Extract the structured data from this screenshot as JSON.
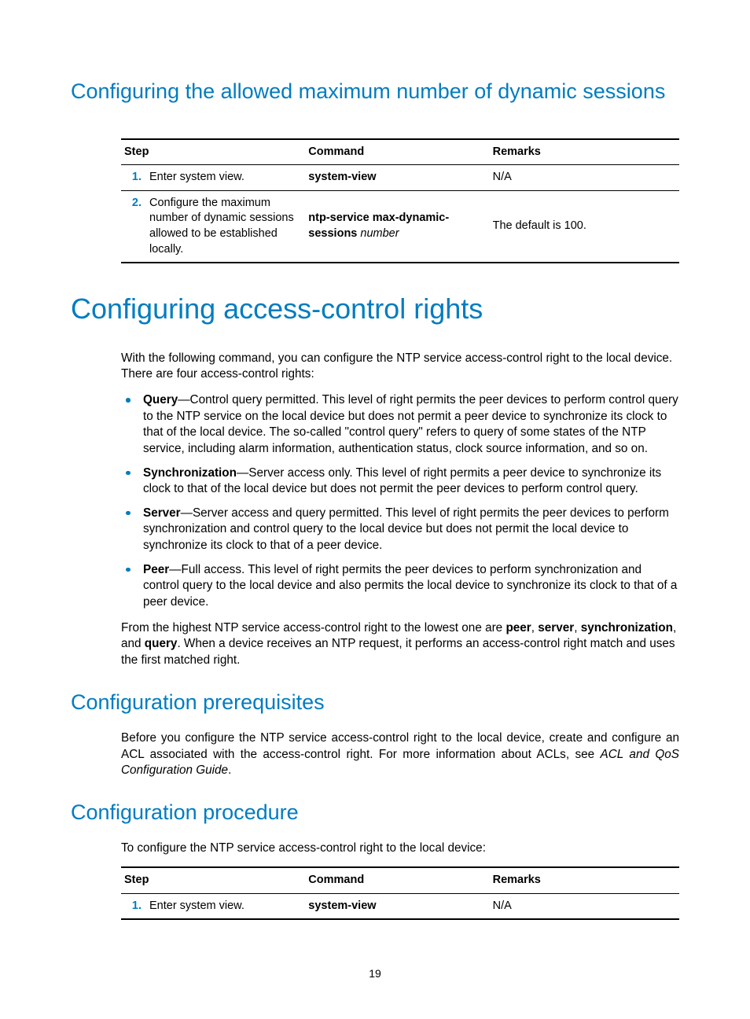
{
  "section1": {
    "title": "Configuring the allowed maximum number of dynamic sessions",
    "table": {
      "headers": {
        "step": "Step",
        "command": "Command",
        "remarks": "Remarks"
      },
      "rows": [
        {
          "num": "1.",
          "step": "Enter system view.",
          "cmd_bold": "system-view",
          "cmd_ital": "",
          "remarks": "N/A"
        },
        {
          "num": "2.",
          "step": "Configure the maximum number of dynamic sessions allowed to be established locally.",
          "cmd_bold": "ntp-service max-dynamic-sessions",
          "cmd_ital": "number",
          "remarks": "The default is 100."
        }
      ]
    }
  },
  "section2": {
    "title": "Configuring access-control rights",
    "intro": "With the following command, you can configure the NTP service access-control right to the local device. There are four access-control rights:",
    "bullets": [
      {
        "term": "Query",
        "desc": "—Control query permitted. This level of right permits the peer devices to perform control query to the NTP service on the local device but does not permit a peer device to synchronize its clock to that of the local device. The so-called \"control query\" refers to query of some states of the NTP service, including alarm information, authentication status, clock source information, and so on."
      },
      {
        "term": "Synchronization",
        "desc": "—Server access only. This level of right permits a peer device to synchronize its clock to that of the local device but does not permit the peer devices to perform control query."
      },
      {
        "term": "Server",
        "desc": "—Server access and query permitted. This level of right permits the peer devices to perform synchronization and control query to the local device but does not permit the local device to synchronize its clock to that of a peer device."
      },
      {
        "term": "Peer",
        "desc": "—Full access. This level of right permits the peer devices to perform synchronization and control query to the local device and also permits the local device to synchronize its clock to that of a peer device."
      }
    ],
    "tail_pre": "From the highest NTP service access-control right to the lowest one are ",
    "tail_terms": [
      "peer",
      "server",
      "synchronization",
      "query"
    ],
    "tail_post": ". When a device receives an NTP request, it performs an access-control right match and uses the first matched right."
  },
  "section3": {
    "title": "Configuration prerequisites",
    "body_pre": "Before you configure the NTP service access-control right to the local device, create and configure an ACL associated with the access-control right. For more information about ACLs, see ",
    "body_ital": "ACL and QoS Configuration Guide",
    "body_post": "."
  },
  "section4": {
    "title": "Configuration procedure",
    "intro": "To configure the NTP service access-control right to the local device:",
    "table": {
      "headers": {
        "step": "Step",
        "command": "Command",
        "remarks": "Remarks"
      },
      "rows": [
        {
          "num": "1.",
          "step": "Enter system view.",
          "cmd_bold": "system-view",
          "cmd_ital": "",
          "remarks": "N/A"
        }
      ]
    }
  },
  "page_number": "19"
}
